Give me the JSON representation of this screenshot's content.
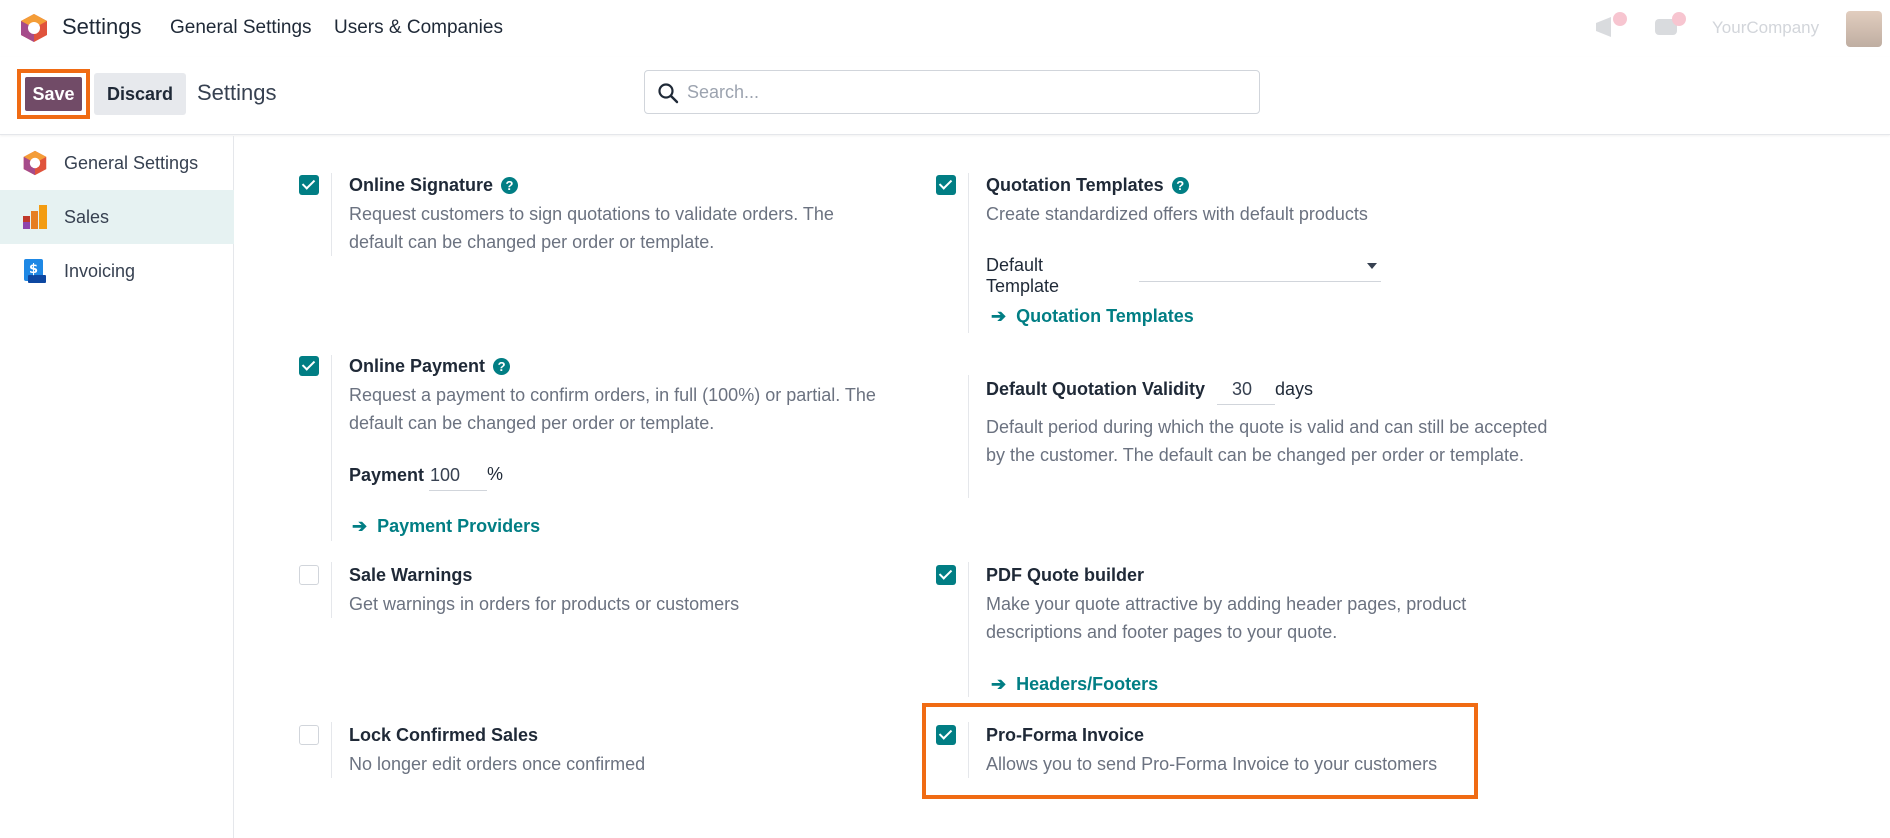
{
  "app": {
    "name": "Settings"
  },
  "nav": {
    "menu": [
      "General Settings",
      "Users & Companies"
    ],
    "company": "YourCompany"
  },
  "control": {
    "save": "Save",
    "discard": "Discard",
    "breadcrumb": "Settings"
  },
  "search": {
    "placeholder": "Search...",
    "value": ""
  },
  "sidebar": {
    "items": [
      {
        "label": "General Settings",
        "icon": "odoo-logo-icon",
        "active": false
      },
      {
        "label": "Sales",
        "icon": "sales-chart-icon",
        "active": true
      },
      {
        "label": "Invoicing",
        "icon": "invoice-dollar-icon",
        "active": false
      }
    ]
  },
  "settings": {
    "online_signature": {
      "title": "Online Signature",
      "checked": true,
      "desc": "Request customers to sign quotations to validate orders. The default can be changed per order or template."
    },
    "quotation_templates": {
      "title": "Quotation Templates",
      "checked": true,
      "desc": "Create standardized offers with default products",
      "field_label": "Default Template",
      "field_value": "",
      "link": "Quotation Templates"
    },
    "online_payment": {
      "title": "Online Payment",
      "checked": true,
      "desc": "Request a payment to confirm orders, in full (100%) or partial. The default can be changed per order or template.",
      "field_label": "Payment",
      "field_value": "100",
      "unit": "%",
      "link": "Payment Providers"
    },
    "quotation_validity": {
      "title": "Default Quotation Validity",
      "value": "30",
      "unit": "days",
      "desc": "Default period during which the quote is valid and can still be accepted by the customer. The default can be changed per order or template."
    },
    "sale_warnings": {
      "title": "Sale Warnings",
      "checked": false,
      "desc": "Get warnings in orders for products or customers"
    },
    "pdf_quote_builder": {
      "title": "PDF Quote builder",
      "checked": true,
      "desc": "Make your quote attractive by adding header pages, product descriptions and footer pages to your quote.",
      "link": "Headers/Footers"
    },
    "lock_confirmed_sales": {
      "title": "Lock Confirmed Sales",
      "checked": false,
      "desc": "No longer edit orders once confirmed"
    },
    "pro_forma_invoice": {
      "title": "Pro-Forma Invoice",
      "checked": true,
      "desc": "Allows you to send Pro-Forma Invoice to your customers"
    }
  },
  "colors": {
    "primary": "#714b67",
    "accent": "#017e84",
    "highlight": "#f06b13",
    "sidebar_active": "#e6f2f2"
  }
}
